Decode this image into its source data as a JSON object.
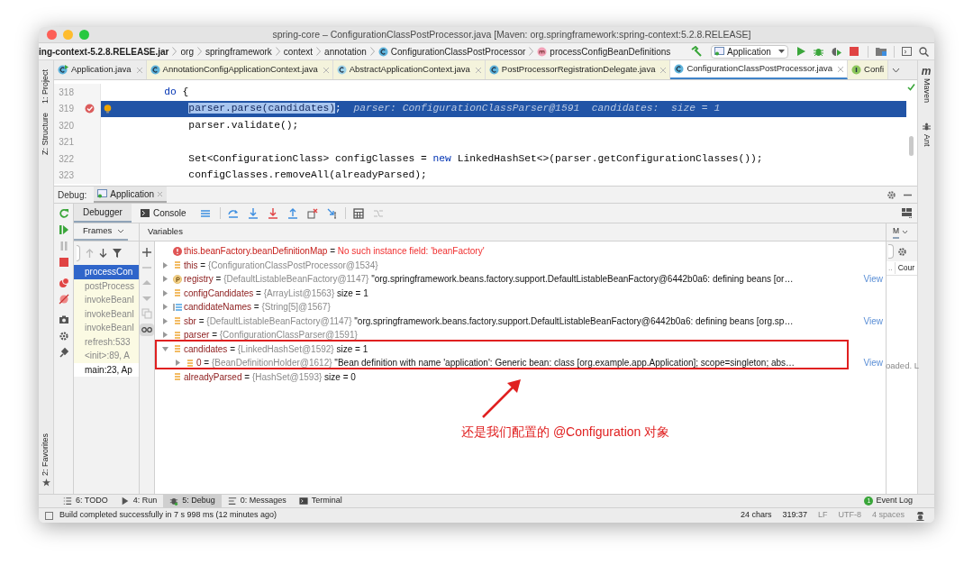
{
  "window": {
    "title": "spring-core – ConfigurationClassPostProcessor.java [Maven: org.springframework:spring-context:5.2.8.RELEASE]"
  },
  "breadcrumbs": [
    {
      "label": "ing-context-5.2.8.RELEASE.jar",
      "kind": "jar"
    },
    {
      "label": "org",
      "kind": "package"
    },
    {
      "label": "springframework",
      "kind": "package"
    },
    {
      "label": "context",
      "kind": "package"
    },
    {
      "label": "annotation",
      "kind": "package"
    },
    {
      "label": "ConfigurationClassPostProcessor",
      "kind": "class"
    },
    {
      "label": "processConfigBeanDefinitions",
      "kind": "method"
    }
  ],
  "run_config": "Application",
  "editor_tabs": [
    {
      "label": "Application.java",
      "kind": "main",
      "selected": false,
      "library": false
    },
    {
      "label": "AnnotationConfigApplicationContext.java",
      "kind": "class",
      "selected": false,
      "library": true
    },
    {
      "label": "AbstractApplicationContext.java",
      "kind": "abstract",
      "selected": false,
      "library": true
    },
    {
      "label": "PostProcessorRegistrationDelegate.java",
      "kind": "class",
      "selected": false,
      "library": true
    },
    {
      "label": "ConfigurationClassPostProcessor.java",
      "kind": "class",
      "selected": true,
      "library": true
    },
    {
      "label": "Confi",
      "kind": "interface",
      "selected": false,
      "library": true
    }
  ],
  "left_tools": [
    {
      "label": "1: Project",
      "kind": "top"
    },
    {
      "label": "Z: Structure",
      "kind": "top"
    },
    {
      "label": "2: Favorites",
      "kind": "bottom"
    }
  ],
  "right_tools": [
    {
      "label": "Maven",
      "kind": "maven"
    },
    {
      "label": "Ant",
      "kind": "ant"
    }
  ],
  "maven_mark": "m",
  "editor": {
    "lines": [
      {
        "number": "318",
        "highlighted": false,
        "breakpoint": false,
        "intention": false,
        "tokens": [
          {
            "text": "        do",
            "kind": "keyword"
          },
          {
            "text": " {",
            "kind": "plain"
          }
        ]
      },
      {
        "number": "319",
        "highlighted": true,
        "breakpoint": true,
        "intention": true,
        "tokens": [
          {
            "text": "            parser.parse(candidates)",
            "kind": "selection"
          },
          {
            "text": ";  ",
            "kind": "plain"
          },
          {
            "text": "parser: ConfigurationClassParser@1591  candidates:  size = 1",
            "kind": "hint"
          }
        ]
      },
      {
        "number": "320",
        "highlighted": false,
        "breakpoint": false,
        "intention": false,
        "tokens": [
          {
            "text": "            parser.validate();",
            "kind": "plain"
          }
        ]
      },
      {
        "number": "321",
        "highlighted": false,
        "breakpoint": false,
        "intention": false
      },
      {
        "number": "322",
        "highlighted": false,
        "breakpoint": false,
        "intention": false,
        "tokens": [
          {
            "text": "            Set<ConfigurationClass> configClasses = ",
            "kind": "plain"
          },
          {
            "text": "new",
            "kind": "keyword"
          },
          {
            "text": " LinkedHashSet<>(parser.getConfigurationClasses());",
            "kind": "plain"
          }
        ]
      },
      {
        "number": "323",
        "highlighted": false,
        "breakpoint": false,
        "intention": false,
        "tokens": [
          {
            "text": "            configClasses.removeAll(alreadyParsed);",
            "kind": "plain"
          }
        ]
      }
    ]
  },
  "debug": {
    "label": "Debug:",
    "session": "Application",
    "tabs": [
      {
        "label": "Debugger",
        "selected": true
      },
      {
        "label": "Console",
        "selected": false
      }
    ],
    "frames_header": "Frames",
    "variables_header": "Variables",
    "frames": [
      {
        "label": "processCon",
        "selected": true,
        "library": true
      },
      {
        "label": "postProcess",
        "selected": false,
        "library": true
      },
      {
        "label": "invokeBeanI",
        "selected": false,
        "library": true
      },
      {
        "label": "invokeBeanI",
        "selected": false,
        "library": true
      },
      {
        "label": "invokeBeanI",
        "selected": false,
        "library": true
      },
      {
        "label": "refresh:533",
        "selected": false,
        "library": true
      },
      {
        "label": "<init>:89, A",
        "selected": false,
        "library": true
      },
      {
        "label": "main:23, Ap",
        "selected": false,
        "library": false
      }
    ],
    "variables": [
      {
        "kind": "error",
        "name": "this.beanFactory.beanDefinitionMap",
        "separator": "=",
        "value": "No such instance field: 'beanFactory'",
        "expandable": false
      },
      {
        "kind": "field",
        "name": "this",
        "separator": "=",
        "ref": "{ConfigurationClassPostProcessor@1534}",
        "expandable": true,
        "expanded": false
      },
      {
        "kind": "param",
        "name": "registry",
        "separator": "=",
        "ref": "{DefaultListableBeanFactory@1147}",
        "value": "\"org.springframework.beans.factory.support.DefaultListableBeanFactory@6442b0a6: defining beans [or…",
        "link": "View",
        "expandable": true,
        "expanded": false
      },
      {
        "kind": "field",
        "name": "configCandidates",
        "separator": "=",
        "ref": "{ArrayList@1563}",
        "value": "size = 1",
        "expandable": true,
        "expanded": false
      },
      {
        "kind": "array",
        "name": "candidateNames",
        "separator": "=",
        "ref": "{String[5]@1567}",
        "expandable": true,
        "expanded": false
      },
      {
        "kind": "field",
        "name": "sbr",
        "separator": "=",
        "ref": "{DefaultListableBeanFactory@1147}",
        "value": "\"org.springframework.beans.factory.support.DefaultListableBeanFactory@6442b0a6: defining beans [org.sp…",
        "link": "View",
        "expandable": true,
        "expanded": false
      },
      {
        "kind": "field",
        "name": "parser",
        "separator": "=",
        "ref": "{ConfigurationClassParser@1591}",
        "expandable": true,
        "expanded": false
      },
      {
        "kind": "field",
        "name": "candidates",
        "separator": "=",
        "ref": "{LinkedHashSet@1592}",
        "value": "size = 1",
        "expandable": true,
        "expanded": true,
        "children": [
          {
            "kind": "field",
            "name": "0",
            "separator": "=",
            "ref": "{BeanDefinitionHolder@1612}",
            "value": "\"Bean definition with name 'application': Generic bean: class [org.example.app.Application]; scope=singleton; abs…",
            "link": "View",
            "expandable": true,
            "expanded": false
          }
        ]
      },
      {
        "kind": "field",
        "name": "alreadyParsed",
        "separator": "=",
        "ref": "{HashSet@1593}",
        "value": "size = 0",
        "expandable": false
      }
    ],
    "side_panel": {
      "tab": "M",
      "column": "Cour",
      "column_prefix": "..",
      "message": "oaded. L"
    }
  },
  "annotation": {
    "text": "还是我们配置的 @Configuration 对象"
  },
  "bottom_tools": [
    {
      "label": "6: TODO",
      "kind": "todo",
      "selected": false
    },
    {
      "label": "4: Run",
      "kind": "run",
      "selected": false
    },
    {
      "label": "5: Debug",
      "kind": "debug",
      "selected": true
    },
    {
      "label": "0: Messages",
      "kind": "messages",
      "selected": false
    },
    {
      "label": "Terminal",
      "kind": "terminal",
      "selected": false
    }
  ],
  "event_log": {
    "label": "Event Log",
    "count": "1"
  },
  "status_bar": {
    "message": "Build completed successfully in 7 s 998 ms (12 minutes ago)",
    "items": [
      {
        "text": "24 chars",
        "muted": false
      },
      {
        "text": "319:37",
        "muted": false
      },
      {
        "text": "LF",
        "muted": true
      },
      {
        "text": "UTF-8",
        "muted": true
      },
      {
        "text": "4 spaces",
        "muted": true
      }
    ]
  }
}
